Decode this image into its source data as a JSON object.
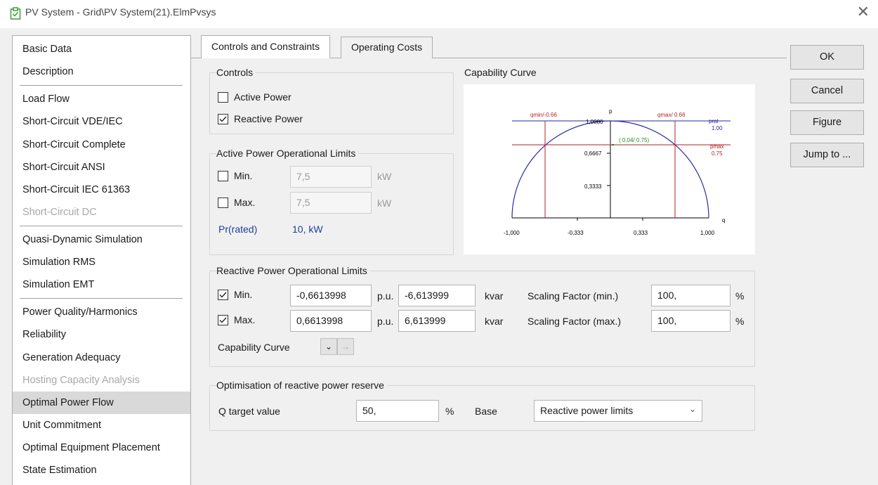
{
  "window": {
    "title": "PV System - Grid\\PV System(21).ElmPvsys"
  },
  "nav": {
    "items": [
      {
        "label": "Basic Data",
        "disabled": false
      },
      {
        "label": "Description",
        "disabled": false
      },
      {
        "label": "Load Flow",
        "disabled": false
      },
      {
        "label": "Short-Circuit VDE/IEC",
        "disabled": false
      },
      {
        "label": "Short-Circuit Complete",
        "disabled": false
      },
      {
        "label": "Short-Circuit ANSI",
        "disabled": false
      },
      {
        "label": "Short-Circuit IEC 61363",
        "disabled": false
      },
      {
        "label": "Short-Circuit DC",
        "disabled": true
      },
      {
        "label": "Quasi-Dynamic Simulation",
        "disabled": false
      },
      {
        "label": "Simulation RMS",
        "disabled": false
      },
      {
        "label": "Simulation EMT",
        "disabled": false
      },
      {
        "label": "Power Quality/Harmonics",
        "disabled": false
      },
      {
        "label": "Reliability",
        "disabled": false
      },
      {
        "label": "Generation Adequacy",
        "disabled": false
      },
      {
        "label": "Hosting Capacity Analysis",
        "disabled": true
      },
      {
        "label": "Optimal Power Flow",
        "disabled": false,
        "selected": true
      },
      {
        "label": "Unit Commitment",
        "disabled": false
      },
      {
        "label": "Optimal Equipment Placement",
        "disabled": false
      },
      {
        "label": "State Estimation",
        "disabled": false
      }
    ]
  },
  "tabs": [
    {
      "label": "Controls and Constraints",
      "active": true
    },
    {
      "label": "Operating Costs",
      "active": false
    }
  ],
  "buttons": {
    "ok": "OK",
    "cancel": "Cancel",
    "figure": "Figure",
    "jump": "Jump to ..."
  },
  "controls": {
    "title": "Controls",
    "active_power": {
      "label": "Active Power",
      "checked": false
    },
    "reactive_power": {
      "label": "Reactive Power",
      "checked": true
    }
  },
  "active_limits": {
    "title": "Active Power Operational Limits",
    "min": {
      "label": "Min.",
      "checked": false,
      "value": "7,5",
      "unit": "kW"
    },
    "max": {
      "label": "Max.",
      "checked": false,
      "value": "7,5",
      "unit": "kW"
    },
    "rated": {
      "label": "Pr(rated)",
      "value": "10, kW"
    }
  },
  "capability": {
    "title": "Capability Curve",
    "labels": {
      "p": "p",
      "q": "q",
      "qmin": "qmin/-0.66",
      "qmax": "qmax/ 0.66",
      "prat": "prat",
      "prat_val": "1.00",
      "pmax": "pmax",
      "pmax_val": "0.75",
      "point": "( 0.04/ 0.75)",
      "y1": "1,0000",
      "y2": "0,6667",
      "y3": "0,3333",
      "x1": "-1,000",
      "x2": "-0,333",
      "x3": "0,333",
      "x4": "1,000"
    },
    "colors": {
      "curve": "#2a2aa0",
      "limit": "#b22222",
      "point": "#1e8a1e",
      "axis": "#000000"
    }
  },
  "reactive_limits": {
    "title": "Reactive Power Operational Limits",
    "min": {
      "label": "Min.",
      "checked": true,
      "pu": "-0,6613998",
      "pu_unit": "p.u.",
      "kvar": "-6,613999",
      "kvar_unit": "kvar",
      "scale_label": "Scaling Factor (min.)",
      "scale": "100,",
      "scale_unit": "%"
    },
    "max": {
      "label": "Max.",
      "checked": true,
      "pu": "0,6613998",
      "pu_unit": "p.u.",
      "kvar": "6,613999",
      "kvar_unit": "kvar",
      "scale_label": "Scaling Factor (max.)",
      "scale": "100,",
      "scale_unit": "%"
    },
    "capability_label": "Capability Curve"
  },
  "optimisation": {
    "title": "Optimisation of reactive power reserve",
    "q_label": "Q target value",
    "q_value": "50,",
    "q_unit": "%",
    "base_label": "Base",
    "base_value": "Reactive power limits"
  }
}
